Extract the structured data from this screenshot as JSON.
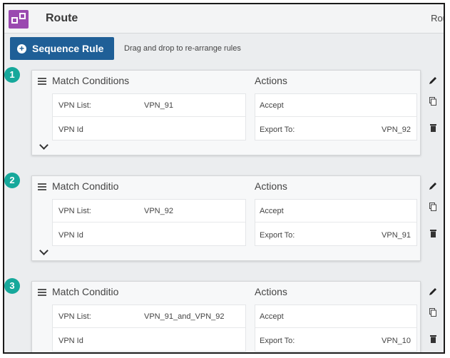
{
  "header": {
    "title": "Route",
    "right_text": "Rou",
    "icon": "route-policy-icon"
  },
  "toolbar": {
    "sequence_button": "Sequence Rule",
    "drag_hint": "Drag and drop to re-arrange rules"
  },
  "rules": [
    {
      "number": "1",
      "match_title": "Match Conditions",
      "actions_title": "Actions",
      "conditions": [
        {
          "label": "VPN List:",
          "value": "VPN_91"
        },
        {
          "label": "VPN Id",
          "value": ""
        }
      ],
      "actions": [
        {
          "label": "Accept",
          "value": ""
        },
        {
          "label": "Export To:",
          "value": "VPN_92"
        }
      ]
    },
    {
      "number": "2",
      "match_title": "Match Conditio",
      "actions_title": "Actions",
      "conditions": [
        {
          "label": "VPN List:",
          "value": "VPN_92"
        },
        {
          "label": "VPN Id",
          "value": ""
        }
      ],
      "actions": [
        {
          "label": "Accept",
          "value": ""
        },
        {
          "label": "Export To:",
          "value": "VPN_91"
        }
      ]
    },
    {
      "number": "3",
      "match_title": "Match Conditio",
      "actions_title": "Actions",
      "conditions": [
        {
          "label": "VPN List:",
          "value": "VPN_91_and_VPN_92"
        },
        {
          "label": "VPN Id",
          "value": ""
        }
      ],
      "actions": [
        {
          "label": "Accept",
          "value": ""
        },
        {
          "label": "Export To:",
          "value": "VPN_10"
        }
      ]
    }
  ],
  "icons": {
    "edit": "pencil-icon",
    "copy": "copy-icon",
    "delete": "trash-icon",
    "expand": "chevron-down-icon",
    "drag": "hamburger-icon"
  },
  "colors": {
    "accent": "#1f5f97",
    "badge": "#16a89b",
    "app_icon": "#9a4ab0"
  }
}
